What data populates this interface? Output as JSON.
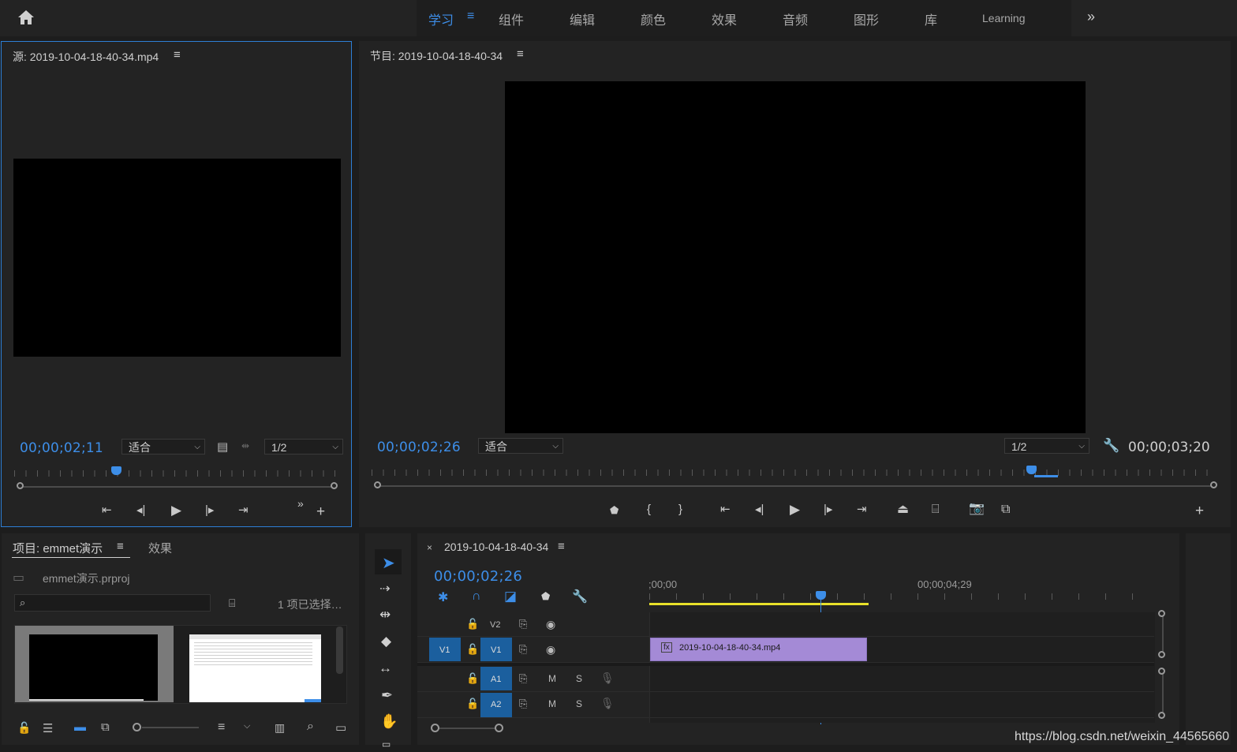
{
  "workspaces": {
    "tabs": [
      "学习",
      "组件",
      "编辑",
      "颜色",
      "效果",
      "音频",
      "图形",
      "库",
      "Learning"
    ],
    "active": "学习",
    "menu_icon": "hamburger-icon",
    "more_icon": "double-chevron-right-icon"
  },
  "source_monitor": {
    "title": "源: 2019-10-04-18-40-34.mp4",
    "timecode": "00;00;02;11",
    "fit": "适合",
    "resolution": "1/2"
  },
  "program_monitor": {
    "title": "节目: 2019-10-04-18-40-34",
    "timecode": "00;00;02;26",
    "fit": "适合",
    "resolution": "1/2",
    "duration": "00;00;03;20"
  },
  "project_panel": {
    "tab_project": "项目: emmet演示",
    "tab_effects": "效果",
    "file": "emmet演示.prproj",
    "selection": "1 项已选择…"
  },
  "timeline": {
    "title": "2019-10-04-18-40-34",
    "timecode": "00;00;02;26",
    "ruler_start": ";00;00",
    "ruler_mark": "00;00;04;29",
    "tracks": {
      "v2": "V2",
      "v1_source": "V1",
      "v1": "V1",
      "a1": "A1",
      "a2": "A2",
      "mute": "M",
      "solo": "S"
    },
    "clip": {
      "name": "2019-10-04-18-40-34.mp4",
      "badge": "fx"
    }
  },
  "watermark": "https://blog.csdn.net/weixin_44565660",
  "colors": {
    "accent": "#3d8ee8",
    "clip": "#a48ad6",
    "work_area": "#e8e02a",
    "track_target": "#1b5f9e"
  }
}
